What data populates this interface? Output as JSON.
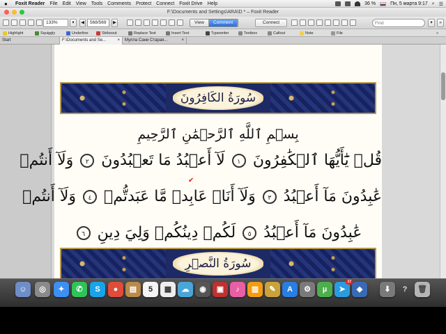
{
  "menubar": {
    "app_name": "Foxit Reader",
    "menus": [
      "File",
      "Edit",
      "View",
      "Tools",
      "Comments",
      "Protect",
      "Connect",
      "Foxit Drive",
      "Help"
    ],
    "battery": "36 %",
    "datetime": "Пн, 5 марта  9:17",
    "search_icon": "search-icon",
    "list_icon": "list-icon"
  },
  "window": {
    "title": "F:\\Documents and Settings\\ARA\\D * – Foxit Reader"
  },
  "toolbar": {
    "zoom": "133%",
    "page": "568/569",
    "view_label": "View",
    "comment_label": "Comment",
    "connect_label": "Connect",
    "find_placeholder": "Find"
  },
  "comment_tools": [
    "Highlight",
    "Squiggly",
    "Underline",
    "Strikeout",
    "Replace Text",
    "Insert Text",
    "Typewriter",
    "Textbox",
    "Callout",
    "Note",
    "File"
  ],
  "tabs": [
    {
      "label": "Start"
    },
    {
      "label": "F:\\Documents and Se...",
      "close": "×"
    },
    {
      "label": "Мулла Сани Старая...",
      "close": "×"
    }
  ],
  "document": {
    "surah_title_1": "سُورَةُ الكَافِرُونَ",
    "basmala": "بِسۡمِ ٱللَّهِ ٱلرَّحۡمَٰنِ ٱلرَّحِيمِ",
    "ayah_1": "قُلۡ يَٰٓأَيُّهَا ٱلۡكَٰفِرُونَ",
    "ayah_1_num": "١",
    "ayah_2": "لَآ أَعۡبُدُ مَا تَعۡبُدُونَ",
    "ayah_2_num": "٢",
    "ayah_3a": "وَلَآ أَنتُمۡ",
    "ayah_3b": "عَٰبِدُونَ مَآ أَعۡبُدُ",
    "ayah_3_num": "٣",
    "ayah_4": "وَلَآ أَنَا۠ عَابِدٞ مَّا عَبَدتُّمۡ",
    "ayah_4_num": "٤",
    "ayah_5a": "وَلَآ أَنتُمۡ",
    "ayah_5b": "عَٰبِدُونَ مَآ أَعۡبُدُ",
    "ayah_5_num": "٥",
    "ayah_6": "لَكُمۡ دِينُكُمۡ وَلِيَ دِينِ",
    "ayah_6_num": "٦",
    "surah_title_2": "سُورَةُ النَّصۡرِ"
  },
  "dock": {
    "calendar_day": "5",
    "badge_count": "17"
  }
}
